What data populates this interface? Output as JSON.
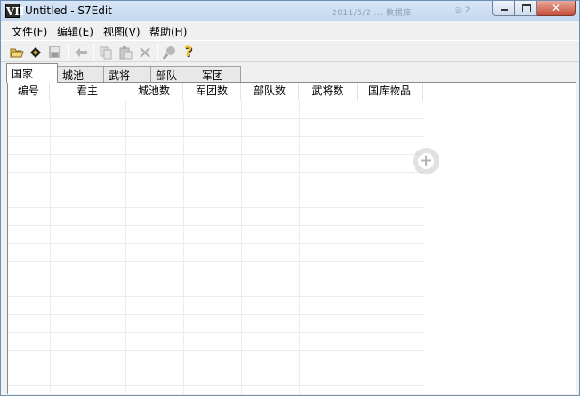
{
  "window": {
    "title": "Untitled - S7Edit",
    "icon_text": "VII",
    "ghost_text_1": "2011/5/2  ... 数据库",
    "ghost_text_2": "◎ 2 ..."
  },
  "menu": [
    "文件(F)",
    "编辑(E)",
    "视图(V)",
    "帮助(H)"
  ],
  "toolbar": {
    "buttons": [
      {
        "name": "open-icon",
        "glyph": "📂",
        "enabled": true
      },
      {
        "name": "edit-tag-icon",
        "glyph": "◆",
        "enabled": true
      },
      {
        "name": "save-icon",
        "glyph": "▪",
        "enabled": false
      },
      {
        "name": "back-arrow-icon",
        "glyph": "⬅",
        "enabled": false
      },
      {
        "name": "copy-icon",
        "glyph": "❐",
        "enabled": false
      },
      {
        "name": "paste-icon",
        "glyph": "📋",
        "enabled": false
      },
      {
        "name": "delete-icon",
        "glyph": "✕",
        "enabled": false
      },
      {
        "name": "find-icon",
        "glyph": "🔍",
        "enabled": false
      },
      {
        "name": "help-icon",
        "glyph": "?",
        "enabled": true
      }
    ]
  },
  "tabs": [
    "国家",
    "城池",
    "武将",
    "部队",
    "军团"
  ],
  "active_tab": "国家",
  "columns": [
    "编号",
    "君主",
    "城池数",
    "军团数",
    "部队数",
    "武将数",
    "国库物品"
  ],
  "rows": [],
  "overlay": {
    "icon": "plus-circle-icon",
    "glyph": "+"
  }
}
